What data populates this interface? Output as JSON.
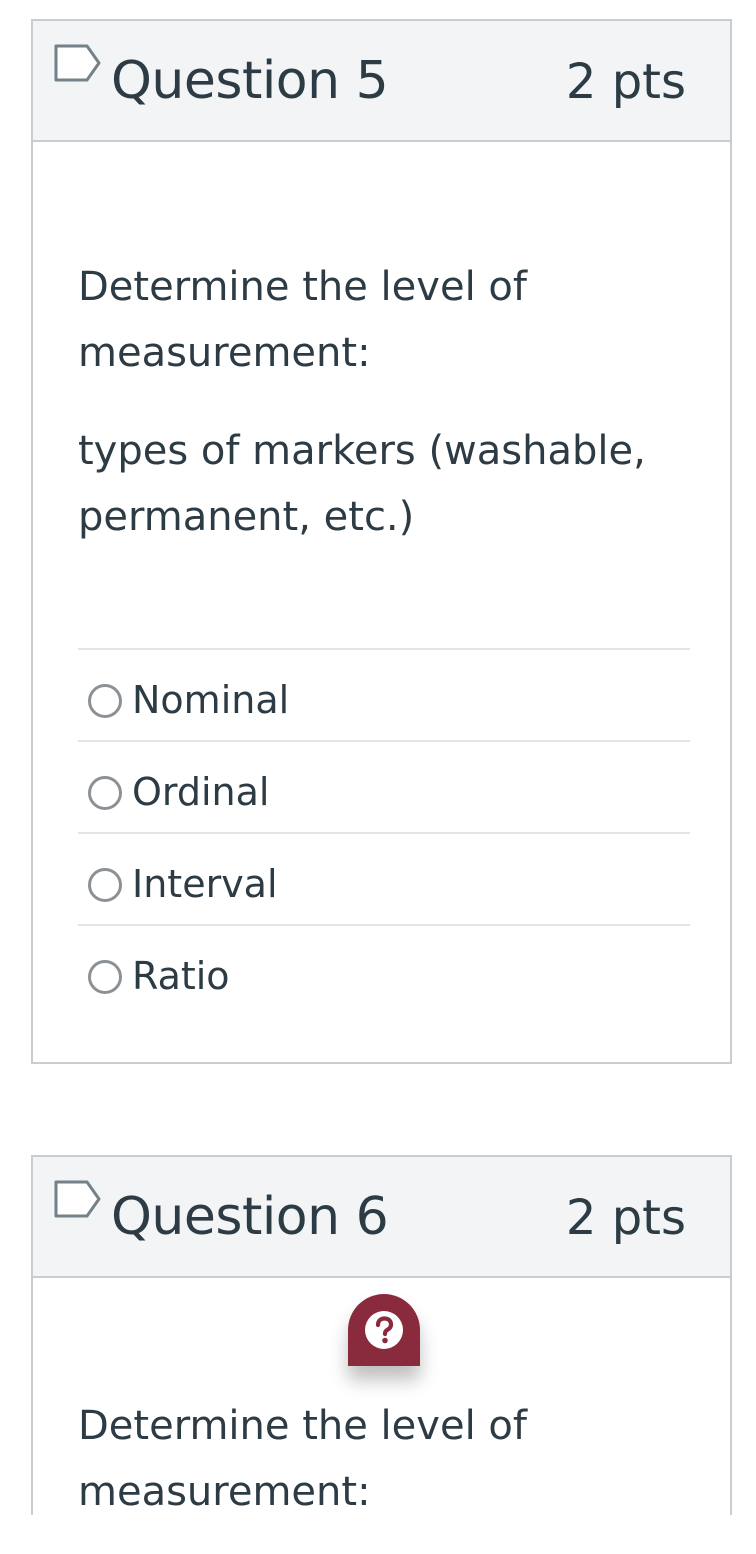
{
  "questions": [
    {
      "title": "Question 5",
      "points": "2 pts",
      "prompt": "Determine the level of measurement:",
      "item": "types of markers (washable, permanent, etc.)",
      "answers": [
        {
          "label": "Nominal",
          "selected": false
        },
        {
          "label": "Ordinal",
          "selected": false
        },
        {
          "label": "Interval",
          "selected": false
        },
        {
          "label": "Ratio",
          "selected": false
        }
      ]
    },
    {
      "title": "Question 6",
      "points": "2 pts",
      "prompt": "Determine the level of measurement:"
    }
  ],
  "icons": {
    "flag": "bookmark-flag-icon",
    "help": "question-mark-icon"
  },
  "colors": {
    "text": "#2d3b45",
    "header_bg": "#f2f4f5",
    "border": "#c7cdd1",
    "help_badge": "#8a2b3d"
  }
}
